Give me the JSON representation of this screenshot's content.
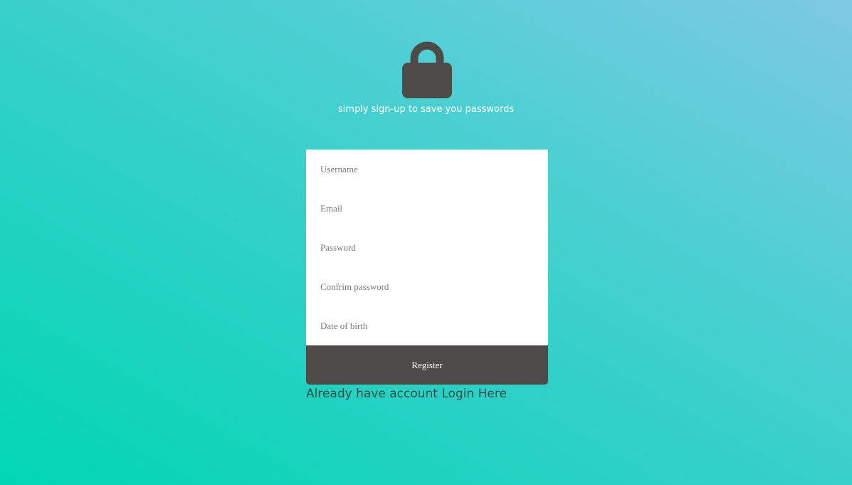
{
  "header": {
    "icon": "lock-icon",
    "tagline": "simply sign-up to save you passwords"
  },
  "form": {
    "fields": [
      {
        "name": "username",
        "placeholder": "Username",
        "value": ""
      },
      {
        "name": "email",
        "placeholder": "Email",
        "value": ""
      },
      {
        "name": "password",
        "placeholder": "Password",
        "value": ""
      },
      {
        "name": "confirm_password",
        "placeholder": "Confrim password",
        "value": ""
      },
      {
        "name": "date_of_birth",
        "placeholder": "Date of birth",
        "value": ""
      }
    ],
    "submit_label": "Register"
  },
  "footer": {
    "login_link": "Already have account Login Here"
  },
  "colors": {
    "background_start": "#00d6b4",
    "background_end": "#7ec8e2",
    "accent_dark": "#4e4a47",
    "card": "#ffffff",
    "tagline_text": "#ffffff"
  }
}
